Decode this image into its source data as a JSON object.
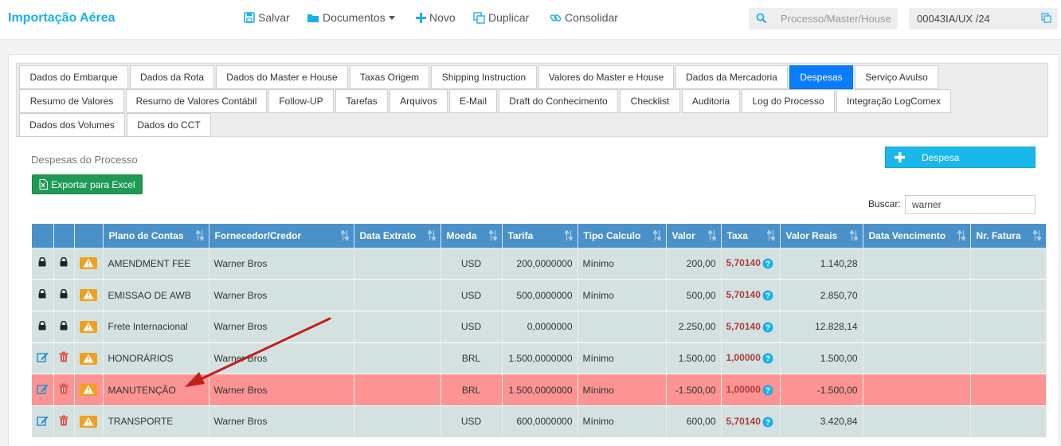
{
  "header": {
    "app_title": "Importação Aérea",
    "salvar": "Salvar",
    "documentos": "Documentos",
    "novo": "Novo",
    "duplicar": "Duplicar",
    "consolidar": "Consolidar",
    "search_placeholder": "Processo/Master/House",
    "process_code": "00043IA/UX /24"
  },
  "tabs": [
    {
      "label": "Dados do Embarque"
    },
    {
      "label": "Dados da Rota"
    },
    {
      "label": "Dados do Master e House"
    },
    {
      "label": "Taxas Origem"
    },
    {
      "label": "Shipping Instruction"
    },
    {
      "label": "Valores do Master e House"
    },
    {
      "label": "Dados da Mercadoria"
    },
    {
      "label": "Despesas"
    },
    {
      "label": "Serviço Avulso"
    },
    {
      "label": "Resumo de Valores"
    },
    {
      "label": "Resumo de Valores Contábil"
    },
    {
      "label": "Follow-UP"
    },
    {
      "label": "Tarefas"
    },
    {
      "label": "Arquivos"
    },
    {
      "label": "E-Mail"
    },
    {
      "label": "Draft do Conhecimento"
    },
    {
      "label": "Checklist"
    },
    {
      "label": "Auditoria"
    },
    {
      "label": "Log do Processo"
    },
    {
      "label": "Integração LogComex"
    },
    {
      "label": "Dados dos Volumes"
    },
    {
      "label": "Dados do CCT"
    }
  ],
  "active_tab": "Despesas",
  "section": {
    "title": "Despesas do Processo",
    "export_label": "Exportar para Excel",
    "add_label": "Despesa",
    "buscar_label": "Buscar:",
    "buscar_value": "warner"
  },
  "table": {
    "columns": [
      "",
      "",
      "",
      "Plano de Contas",
      "Fornecedor/Credor",
      "Data Extrato",
      "Moeda",
      "Tarifa",
      "Tipo Calculo",
      "Valor",
      "Taxa",
      "Valor Reais",
      "Data Vencimento",
      "Nr. Fatura"
    ],
    "rows": [
      {
        "locked": true,
        "plano": "AMENDMENT FEE",
        "fornecedor": "Warner Bros",
        "data_extrato": "",
        "moeda": "USD",
        "tarifa": "200,0000000",
        "tipo": "Mínimo",
        "valor": "200,00",
        "taxa": "5,70140",
        "valor_reais": "1.140,28",
        "vencimento": "",
        "fatura": "",
        "highlight": false
      },
      {
        "locked": true,
        "plano": "EMISSAO DE AWB",
        "fornecedor": "Warner Bros",
        "data_extrato": "",
        "moeda": "USD",
        "tarifa": "500,0000000",
        "tipo": "Mínimo",
        "valor": "500,00",
        "taxa": "5,70140",
        "valor_reais": "2.850,70",
        "vencimento": "",
        "fatura": "",
        "highlight": false
      },
      {
        "locked": true,
        "plano": "Frete Internacional",
        "fornecedor": "Warner Bros",
        "data_extrato": "",
        "moeda": "USD",
        "tarifa": "0,0000000",
        "tipo": "",
        "valor": "2.250,00",
        "taxa": "5,70140",
        "valor_reais": "12.828,14",
        "vencimento": "",
        "fatura": "",
        "highlight": false
      },
      {
        "locked": false,
        "plano": "HONORÁRIOS",
        "fornecedor": "Warner Bros",
        "data_extrato": "",
        "moeda": "BRL",
        "tarifa": "1.500,0000000",
        "tipo": "Mínimo",
        "valor": "1.500,00",
        "taxa": "1,00000",
        "valor_reais": "1.500,00",
        "vencimento": "",
        "fatura": "",
        "highlight": false
      },
      {
        "locked": false,
        "plano": "MANUTENÇÃO",
        "fornecedor": "Warner Bros",
        "data_extrato": "",
        "moeda": "BRL",
        "tarifa": "1.500,0000000",
        "tipo": "Mínimo",
        "valor": "-1.500,00",
        "taxa": "1,00000",
        "valor_reais": "-1.500,00",
        "vencimento": "",
        "fatura": "",
        "highlight": true
      },
      {
        "locked": false,
        "plano": "TRANSPORTE",
        "fornecedor": "Warner Bros",
        "data_extrato": "",
        "moeda": "USD",
        "tarifa": "600,0000000",
        "tipo": "Mínimo",
        "valor": "600,00",
        "taxa": "5,70140",
        "valor_reais": "3.420,84",
        "vencimento": "",
        "fatura": "",
        "highlight": false
      }
    ]
  },
  "colors": {
    "brand": "#1ab0e8",
    "active_tab": "#0a7cff",
    "table_header": "#4a90c9",
    "row_bg": "#d3e2e1",
    "row_highlight": "#fd9494",
    "taxa_text": "#b23b3b",
    "warning": "#f0a020",
    "arrow": "#c0201a"
  }
}
